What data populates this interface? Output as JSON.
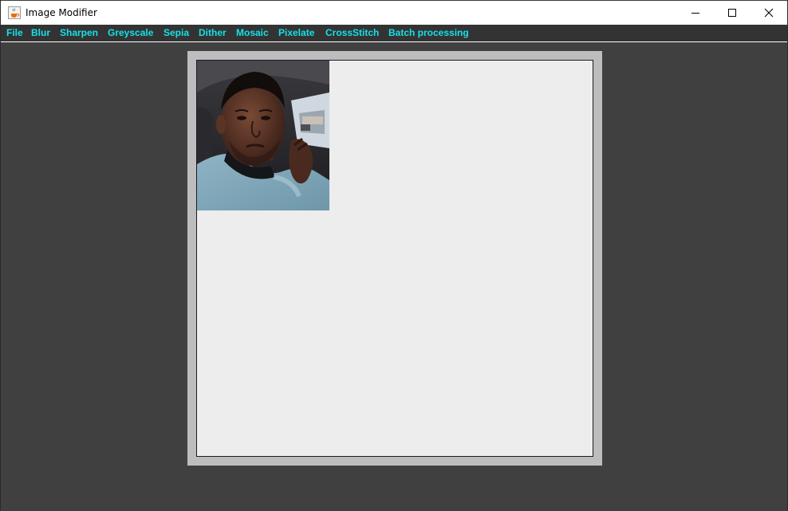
{
  "window": {
    "title": "Image Modifier",
    "icon": "java-cup-icon"
  },
  "menu": {
    "items": [
      {
        "label": "File"
      },
      {
        "label": "Blur"
      },
      {
        "label": "Sharpen"
      },
      {
        "label": "Greyscale"
      },
      {
        "label": "Sepia"
      },
      {
        "label": "Dither"
      },
      {
        "label": "Mosaic"
      },
      {
        "label": "Pixelate"
      },
      {
        "label": "CrossStitch"
      },
      {
        "label": "Batch processing"
      }
    ]
  },
  "colors": {
    "menu_text": "#17e0e8",
    "menu_bg": "#333333",
    "window_bg": "#404040",
    "canvas_frame": "#bdbdbd",
    "canvas_bg": "#ededed"
  },
  "image": {
    "description_icon": "photo-image"
  }
}
